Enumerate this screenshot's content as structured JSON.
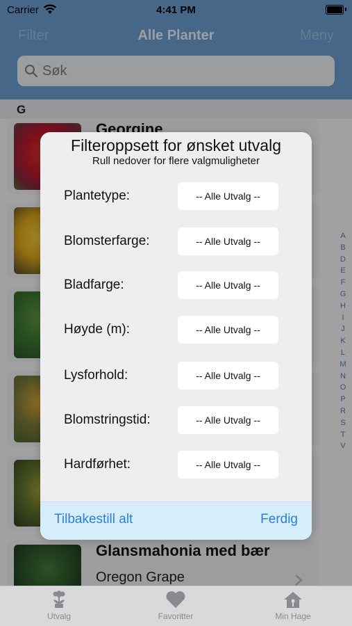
{
  "status_bar": {
    "carrier": "Carrier",
    "time": "4:41 PM"
  },
  "nav": {
    "left": "Filter",
    "title": "Alle Planter",
    "right": "Meny"
  },
  "search": {
    "placeholder": "Søk"
  },
  "section": {
    "letter": "G"
  },
  "plants": [
    {
      "name": "Georgine",
      "subtitle": ""
    },
    {
      "name": "",
      "subtitle": ""
    },
    {
      "name": "",
      "subtitle": ""
    },
    {
      "name": "",
      "subtitle": ""
    },
    {
      "name": "",
      "subtitle": ""
    },
    {
      "name": "Glansmahonia med bær",
      "subtitle": "Oregon Grape"
    }
  ],
  "index_letters": [
    "A",
    "B",
    "D",
    "E",
    "F",
    "G",
    "H",
    "I",
    "J",
    "K",
    "L",
    "M",
    "N",
    "O",
    "P",
    "R",
    "S",
    "T",
    "V"
  ],
  "modal": {
    "title": "Filteroppsett for ønsket utvalg",
    "subtitle": "Rull nedover for flere valgmuligheter",
    "filters": [
      {
        "label": "Plantetype:",
        "value": "-- Alle Utvalg --"
      },
      {
        "label": "Blomsterfarge:",
        "value": "-- Alle Utvalg --"
      },
      {
        "label": "Bladfarge:",
        "value": "-- Alle Utvalg --"
      },
      {
        "label": "Høyde (m):",
        "value": "-- Alle Utvalg --"
      },
      {
        "label": "Lysforhold:",
        "value": "-- Alle Utvalg --"
      },
      {
        "label": "Blomstringstid:",
        "value": "-- Alle Utvalg --"
      },
      {
        "label": "Hardførhet:",
        "value": "-- Alle Utvalg --"
      }
    ],
    "reset_label": "Tilbakestill alt",
    "done_label": "Ferdig"
  },
  "tabs": [
    {
      "label": "Utvalg",
      "icon": "flower-icon"
    },
    {
      "label": "Favoritter",
      "icon": "heart-icon"
    },
    {
      "label": "Min Hage",
      "icon": "house-icon"
    }
  ],
  "colors": {
    "nav_bg": "#6c9fd0",
    "accent": "#2d7fd6",
    "footer_bg": "#d6eef9"
  }
}
